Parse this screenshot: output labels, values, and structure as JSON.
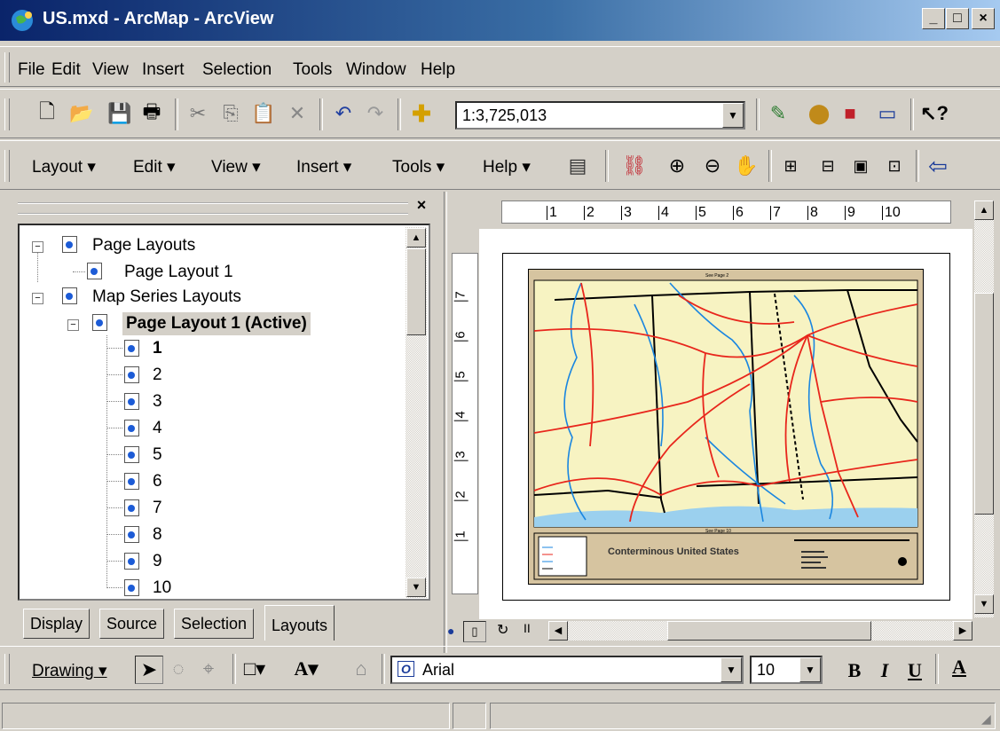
{
  "window": {
    "title": "US.mxd - ArcMap - ArcView",
    "min_label": "_",
    "max_label": "□",
    "close_label": "×"
  },
  "menu": [
    "File",
    "Edit",
    "View",
    "Insert",
    "Selection",
    "Tools",
    "Window",
    "Help"
  ],
  "standard_toolbar": {
    "scale_value": "1:3,725,013"
  },
  "layout_toolbar": {
    "menus": [
      "Layout",
      "Edit",
      "View",
      "Insert",
      "Tools",
      "Help"
    ]
  },
  "toc": {
    "close_label": "×",
    "page_layouts_label": "Page Layouts",
    "page_layout_1": "Page Layout 1",
    "map_series_label": "Map Series Layouts",
    "active_layout": "Page Layout 1 (Active)",
    "pages": [
      "1",
      "2",
      "3",
      "4",
      "5",
      "6",
      "7",
      "8",
      "9",
      "10"
    ],
    "tabs": [
      "Display",
      "Source",
      "Selection",
      "Layouts"
    ]
  },
  "ruler": {
    "top_ticks": [
      "1",
      "2",
      "3",
      "4",
      "5",
      "6",
      "7",
      "8",
      "9",
      "10"
    ],
    "left_ticks": [
      "7",
      "6",
      "5",
      "4",
      "3",
      "2",
      "1"
    ]
  },
  "map": {
    "legend_title": "Conterminous United States",
    "top_label": "See Page 2",
    "bottom_label": "See Page 10",
    "colors": {
      "land": "#f7f3c2",
      "roads": "#e8261c",
      "water": "#1a86e0",
      "border": "#000000",
      "frame": "#d6c4a0"
    }
  },
  "drawing_toolbar": {
    "drawing_label": "Drawing",
    "font_name": "Arial",
    "font_size": "10",
    "bold": "B",
    "italic": "I",
    "underline": "U",
    "font_color": "A"
  }
}
